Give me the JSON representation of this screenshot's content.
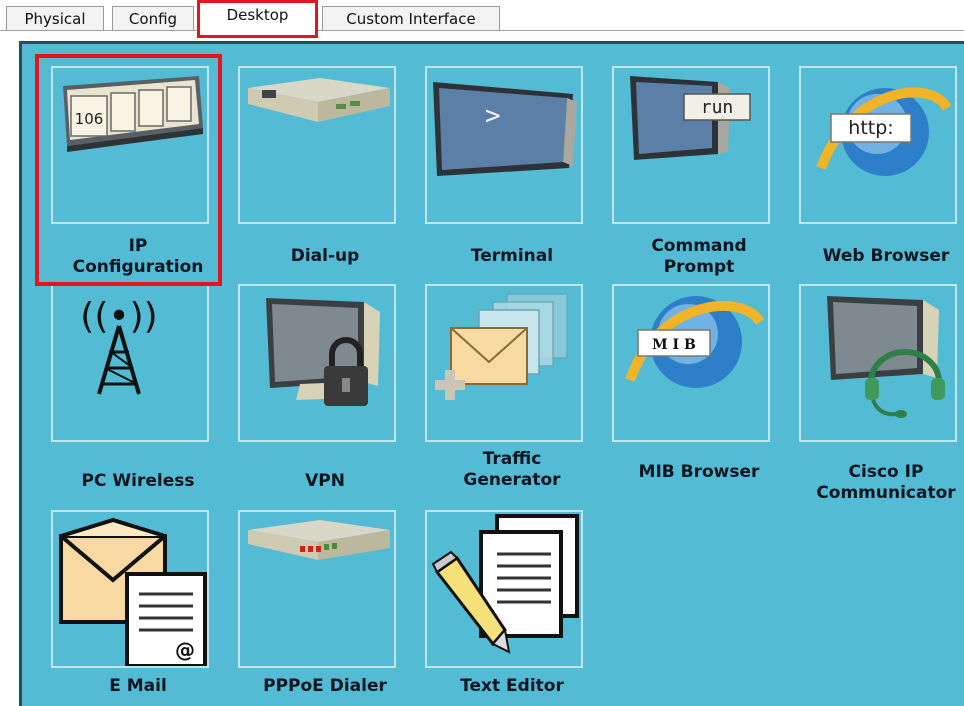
{
  "tabs": [
    {
      "label": "Physical"
    },
    {
      "label": "Config"
    },
    {
      "label": "Desktop"
    },
    {
      "label": "Custom Interface"
    }
  ],
  "active_tab": "Desktop",
  "apps": [
    {
      "label": "IP\nConfiguration",
      "icon": "ip-configuration-icon",
      "badge": "106"
    },
    {
      "label": "Dial-up",
      "icon": "modem-icon"
    },
    {
      "label": "Terminal",
      "icon": "terminal-icon",
      "badge": ">"
    },
    {
      "label": "Command\nPrompt",
      "icon": "command-prompt-icon",
      "badge": "run"
    },
    {
      "label": "Web Browser",
      "icon": "web-browser-icon",
      "badge": "http:"
    },
    {
      "label": "PC Wireless",
      "icon": "wireless-tower-icon",
      "badge": "((•))"
    },
    {
      "label": "VPN",
      "icon": "vpn-lock-icon"
    },
    {
      "label": "Traffic\nGenerator",
      "icon": "traffic-generator-icon"
    },
    {
      "label": "MIB Browser",
      "icon": "mib-browser-icon",
      "badge": "M I B"
    },
    {
      "label": "Cisco IP\nCommunicator",
      "icon": "headset-monitor-icon"
    },
    {
      "label": "E Mail",
      "icon": "email-icon",
      "badge": "@"
    },
    {
      "label": "PPPoE Dialer",
      "icon": "pppoe-dialer-icon"
    },
    {
      "label": "Text Editor",
      "icon": "text-editor-icon"
    }
  ],
  "colors": {
    "desktop_bg": "#54bbd5",
    "highlight": "#e3151e",
    "tile_border": "#bfe7f1"
  }
}
